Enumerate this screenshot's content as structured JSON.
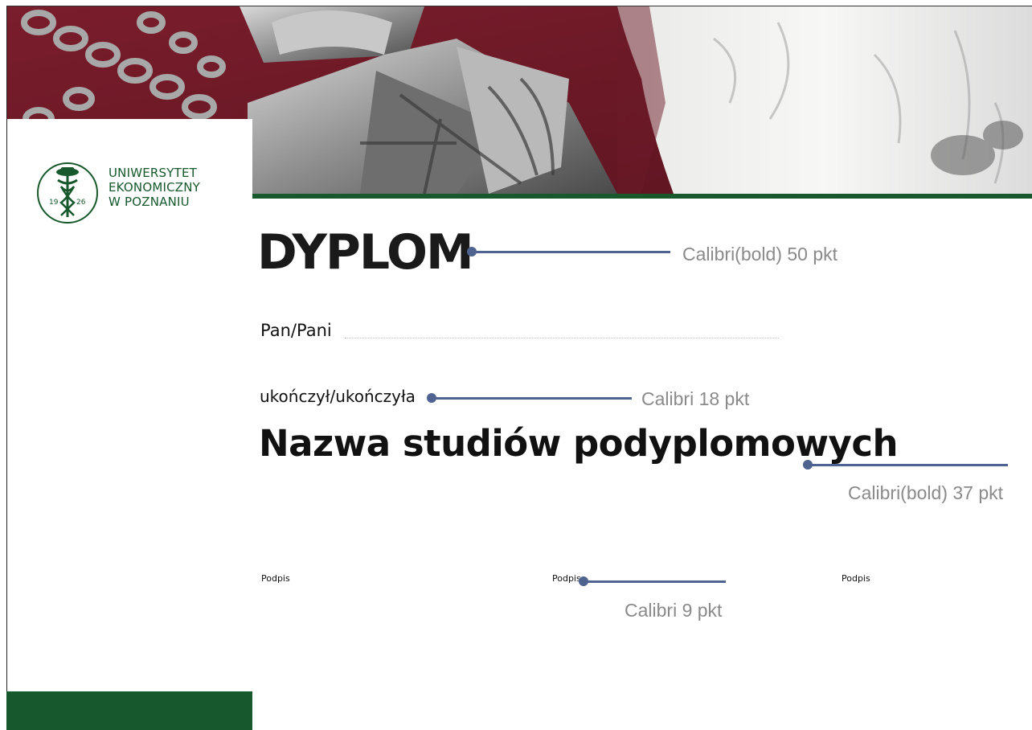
{
  "logo": {
    "line1": "UNIWERSYTET",
    "line2": "EKONOMICZNY",
    "line3": "W POZNANIU",
    "seal_left": "19",
    "seal_right": "26"
  },
  "diploma": {
    "title": "DYPLOM",
    "recipient_label": "Pan/Pani",
    "completed_label": "ukończył/ukończyła",
    "program_name": "Nazwa studiów podyplomowych",
    "signatures": [
      "Podpis",
      "Podpis",
      "Podpis"
    ]
  },
  "annotations": {
    "title_font": "Calibri(bold) 50 pkt",
    "body_font": "Calibri 18 pkt",
    "program_font": "Calibri(bold) 37 pkt",
    "signature_font": "Calibri 9 pkt"
  },
  "colors": {
    "brand_green": "#17582c",
    "leader_blue": "#4f6390",
    "annotation_gray": "#8a8a8a",
    "banner_maroon": "#6b1a27"
  }
}
